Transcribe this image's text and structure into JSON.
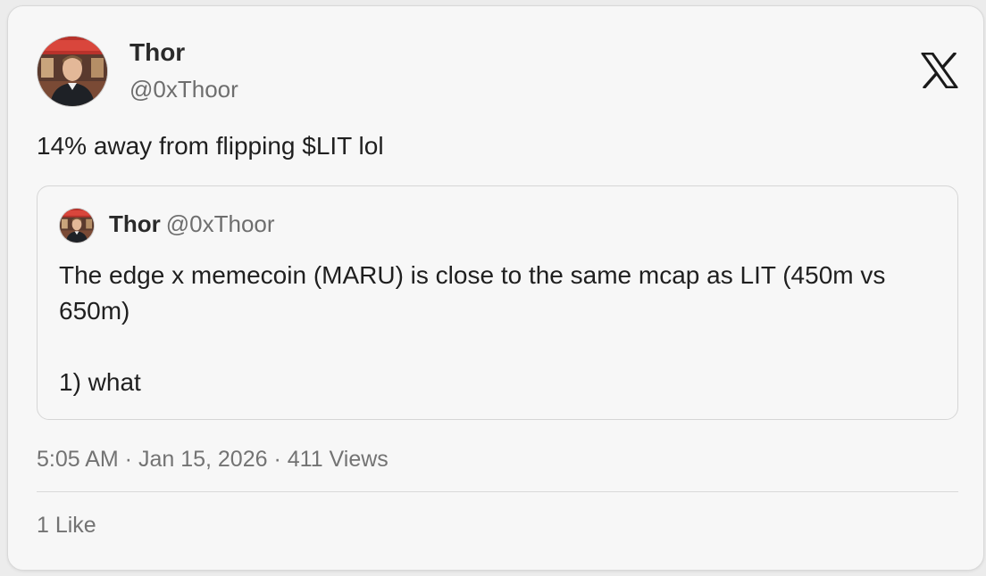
{
  "tweet": {
    "author": {
      "name": "Thor",
      "handle": "@0xThoor",
      "avatar_icon": "profile-photo"
    },
    "text": "14% away from flipping $LIT lol",
    "quoted": {
      "author_name": "Thor",
      "author_handle": "@0xThoor",
      "text_line1": "The edge x memecoin (MARU) is close to the same mcap as LIT (450m vs 650m)",
      "text_line2": "1) what"
    },
    "meta": {
      "time": "5:05 AM",
      "date": "Jan 15, 2026",
      "views": "411 Views",
      "separator": " · "
    },
    "likes": "1 Like"
  },
  "brand": {
    "icon": "x-logo-icon",
    "color": "#1a1a1a"
  }
}
